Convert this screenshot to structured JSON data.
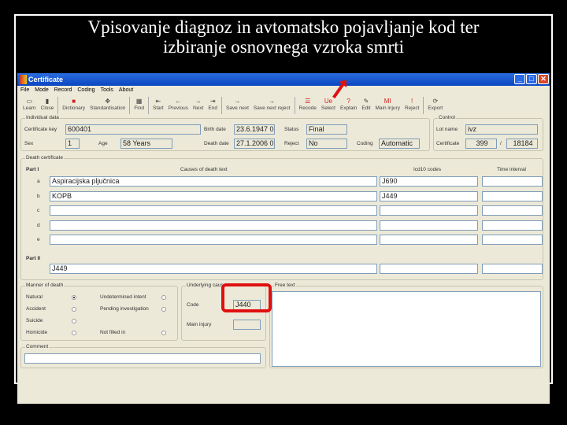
{
  "slide_title_line1": "Vpisovanje diagnoz in avtomatsko pojavljanje kod ter",
  "slide_title_line2": "izbiranje osnovnega vzroka smrti",
  "window": {
    "title": "Certificate",
    "min": "_",
    "max": "□",
    "close": "✕"
  },
  "menu": [
    "File",
    "Mode",
    "Record",
    "Coding",
    "Tools",
    "About"
  ],
  "toolbar": [
    {
      "label": "Learn",
      "icon": "▭"
    },
    {
      "label": "Close",
      "icon": "▮"
    },
    {
      "label": "Dictionary",
      "icon": "■"
    },
    {
      "label": "Standardisation",
      "icon": "✥"
    },
    {
      "label": "Find",
      "icon": "▦"
    },
    {
      "label": "Start",
      "icon": "⇤"
    },
    {
      "label": "Previous",
      "icon": "←"
    },
    {
      "label": "Next",
      "icon": "→"
    },
    {
      "label": "End",
      "icon": "⇥"
    },
    {
      "label": "Save next",
      "icon": "→"
    },
    {
      "label": "Save next reject",
      "icon": "→"
    },
    {
      "label": "Recode",
      "icon": "☰"
    },
    {
      "label": "Select",
      "icon": "Ue"
    },
    {
      "label": "Explain",
      "icon": "?"
    },
    {
      "label": "Edit",
      "icon": "✎"
    },
    {
      "label": "Main injury",
      "icon": "MI"
    },
    {
      "label": "Reject",
      "icon": "!"
    },
    {
      "label": "Export",
      "icon": "⟳"
    }
  ],
  "individual": {
    "group": "Individual data",
    "cert_key_label": "Certificate key",
    "cert_key": "600401",
    "sex_label": "Sex",
    "sex": "1",
    "age_label": "Age",
    "age": "58 Years",
    "birth_label": "Birth date",
    "birth": "23.6.1947 0",
    "death_label": "Death date",
    "death": "27.1.2006 0",
    "status_label": "Status",
    "status": "Final",
    "reject_label": "Reject",
    "reject": "No",
    "coding_label": "Coding",
    "coding": "Automatic"
  },
  "control": {
    "group": "Control",
    "lot_label": "Lot name",
    "lot": "ivz",
    "cert_label": "Certificate",
    "cert_num": "399",
    "sep": "/",
    "cert_total": "18184"
  },
  "death_cert": {
    "group": "Death certificate",
    "part1": "Part I",
    "part2": "Part II",
    "col_causes": "Causes of death text",
    "col_icd": "Icd10 codes",
    "col_time": "Time interval",
    "rows": [
      {
        "letter": "a",
        "text": "Aspiracijska pljučnica",
        "code": "J690"
      },
      {
        "letter": "b",
        "text": "KOPB",
        "code": "J449"
      },
      {
        "letter": "c",
        "text": "",
        "code": ""
      },
      {
        "letter": "d",
        "text": "",
        "code": ""
      },
      {
        "letter": "e",
        "text": "",
        "code": ""
      }
    ],
    "part2_text": "J449"
  },
  "manner": {
    "group": "Manner of death",
    "options": [
      {
        "label": "Natural",
        "selected": true
      },
      {
        "label": "Accident",
        "selected": false
      },
      {
        "label": "Suicide",
        "selected": false
      },
      {
        "label": "Homicide",
        "selected": false
      },
      {
        "label": "Undetermined intent",
        "selected": false
      },
      {
        "label": "Pending investigation",
        "selected": false
      },
      {
        "label": "Not filled in",
        "selected": false
      }
    ]
  },
  "underlying": {
    "group": "Underlying cause",
    "code_label": "Code",
    "code": "J440",
    "main_injury_label": "Main injury",
    "main_injury": ""
  },
  "free_text": {
    "group": "Free text"
  },
  "comment": {
    "group": "Comment",
    "value": ""
  }
}
